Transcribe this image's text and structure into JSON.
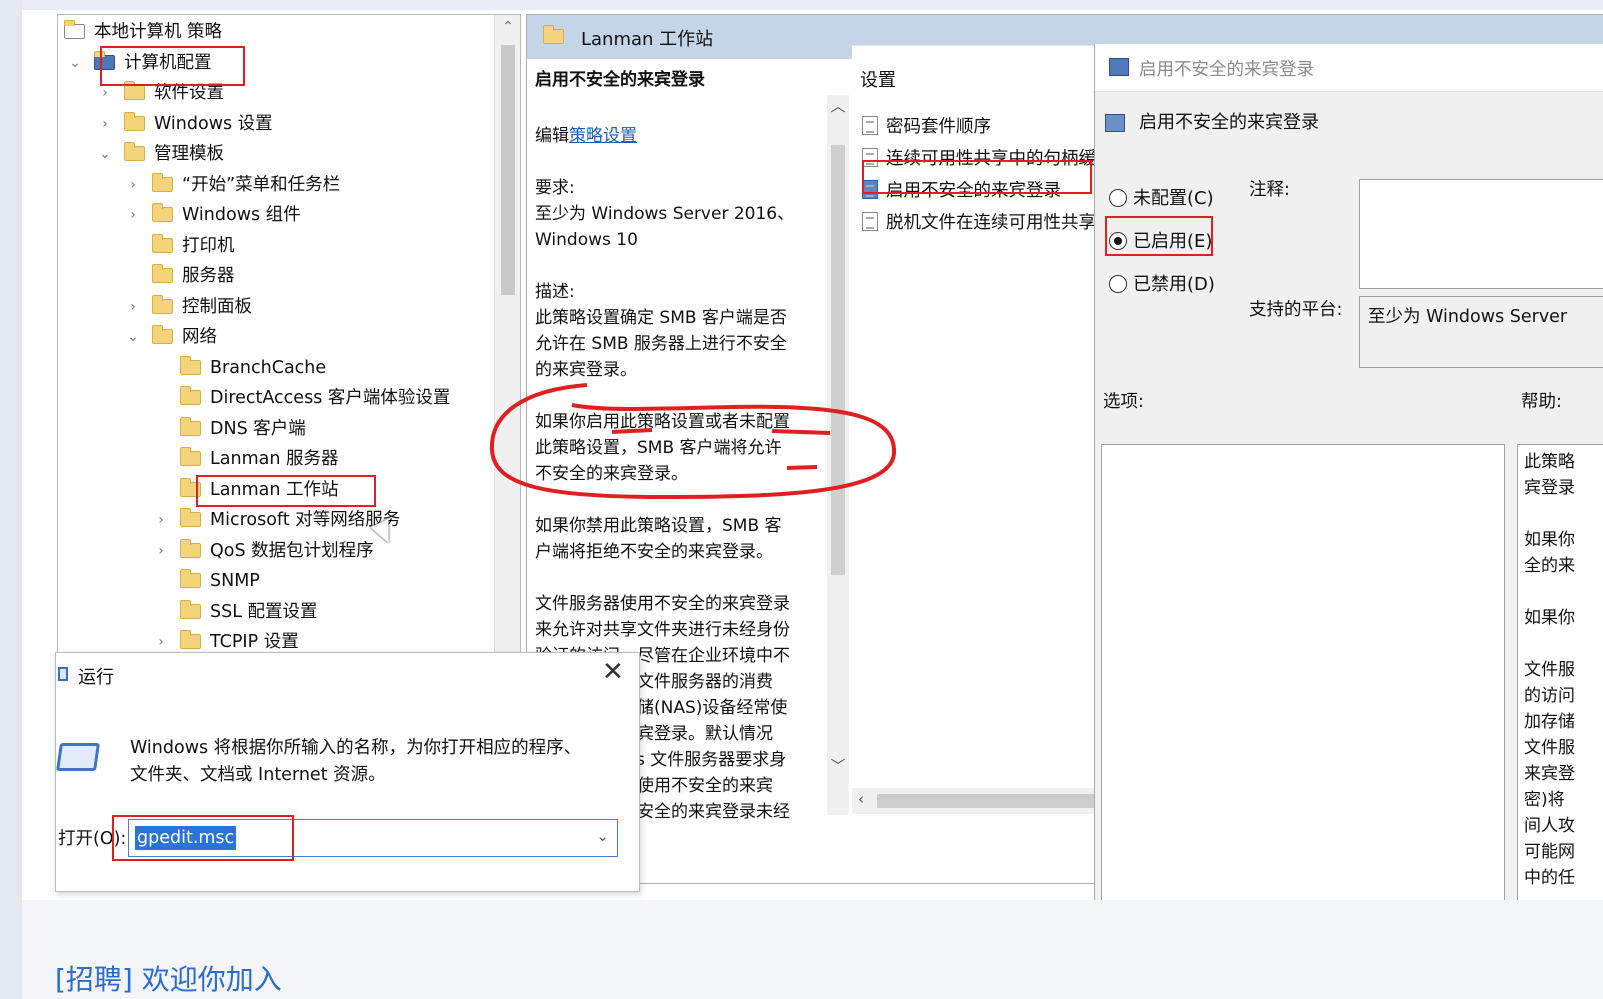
{
  "tree": {
    "items": [
      {
        "label": "本地计算机 策略",
        "chev": ""
      },
      {
        "label": "计算机配置",
        "chev": "⌄"
      },
      {
        "label": "软件设置",
        "chev": "›"
      },
      {
        "label": "Windows 设置",
        "chev": "›"
      },
      {
        "label": "管理模板",
        "chev": "⌄"
      },
      {
        "label": "“开始”菜单和任务栏",
        "chev": "›"
      },
      {
        "label": "Windows 组件",
        "chev": "›"
      },
      {
        "label": "打印机",
        "chev": ""
      },
      {
        "label": "服务器",
        "chev": ""
      },
      {
        "label": "控制面板",
        "chev": "›"
      },
      {
        "label": "网络",
        "chev": "⌄"
      },
      {
        "label": "BranchCache",
        "chev": ""
      },
      {
        "label": "DirectAccess 客户端体验设置",
        "chev": ""
      },
      {
        "label": "DNS 客户端",
        "chev": ""
      },
      {
        "label": "Lanman 服务器",
        "chev": ""
      },
      {
        "label": "Lanman 工作站",
        "chev": ""
      },
      {
        "label": "Microsoft 对等网络服务",
        "chev": "›"
      },
      {
        "label": "QoS 数据包计划程序",
        "chev": "›"
      },
      {
        "label": "SNMP",
        "chev": ""
      },
      {
        "label": "SSL 配置设置",
        "chev": ""
      },
      {
        "label": "TCPIP 设置",
        "chev": "›"
      }
    ]
  },
  "middle": {
    "header": "Lanman 工作站",
    "policy_title": "启用不安全的来宾登录",
    "edit_prefix": "编辑",
    "edit_link": "策略设置",
    "requirement_label": "要求:",
    "requirement_line1": "至少为 Windows Server 2016、",
    "requirement_line2": "Windows 10",
    "desc_label": "描述:",
    "desc_lines": [
      "此策略设置确定 SMB 客户端是否",
      "允许在 SMB 服务器上进行不安全",
      "的来宾登录。"
    ],
    "para2_lines": [
      "如果你启用此策略设置或者未配置",
      "此策略设置，SMB 客户端将允许",
      "不安全的来宾登录。"
    ],
    "para3_lines": [
      "如果你禁用此策略设置，SMB 客",
      "户端将拒绝不安全的来宾登录。"
    ],
    "para4_lines": [
      "文件服务器使用不安全的来宾登录",
      "来允许对共享文件夹进行未经身份",
      "验证的访问。尽管在企业环境中不",
      "常见，但充当文件服务器的消费",
      "类网络附加存储(NAS)设备经常使",
      "用不安全的来宾登录。默认情况",
      "下，Windows 文件服务器要求身",
      "份验证，不会使用不安全的来宾",
      "登录。由于不安全的来宾登录未经"
    ]
  },
  "settings_list": {
    "header": "设置",
    "items": [
      "密码套件顺序",
      "连续可用性共享中的句柄缓存",
      "启用不安全的来宾登录",
      "脱机文件在连续可用性共享上的可用性"
    ]
  },
  "dialog": {
    "title": "启用不安全的来宾登录",
    "heading": "启用不安全的来宾登录",
    "radio_not_configured": "未配置(C)",
    "radio_enabled": "已启用(E)",
    "radio_disabled": "已禁用(D)",
    "comment_label": "注释:",
    "platform_label": "支持的平台:",
    "platform_value": "至少为 Windows Server",
    "options_label": "选项:",
    "help_label": "帮助:",
    "help_lines": [
      "此策略",
      "宾登录",
      "",
      "如果你",
      "全的来",
      "",
      "如果你",
      "",
      "文件服",
      "的访问",
      "加存储",
      "文件服",
      "来宾登",
      "密)将",
      "间人攻",
      "可能网",
      "中的任"
    ]
  },
  "run_dialog": {
    "title": "运行",
    "close": "✕",
    "message_line1": "Windows 将根据你所输入的名称，为你打开相应的程序、",
    "message_line2": "文件夹、文档或 Internet 资源。",
    "open_label": "打开(O):",
    "input_value": "gpedit.msc"
  },
  "footer": {
    "link": "[招聘] 欢迎你加入 "
  }
}
